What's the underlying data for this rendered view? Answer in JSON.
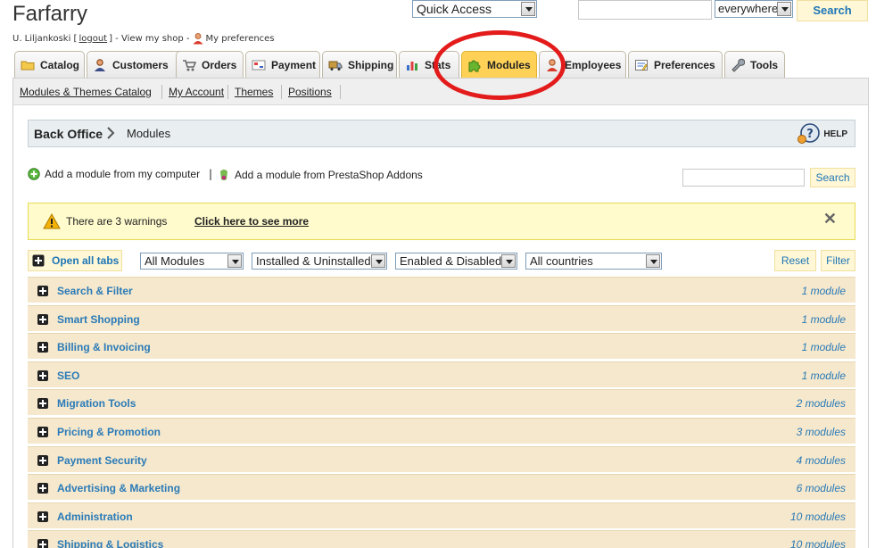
{
  "header": {
    "shop_name": "Farfarry",
    "user": "U. Liljankoski [",
    "logout": "logout",
    "after_logout": "] - View my shop -",
    "preferences": "My preferences"
  },
  "quick_access": {
    "label": "Quick Access"
  },
  "top_search": {
    "scope": "everywhere",
    "button": "Search",
    "value": ""
  },
  "tabs": [
    {
      "label": "Catalog",
      "icon": "folder-icon"
    },
    {
      "label": "Customers",
      "icon": "customers-icon"
    },
    {
      "label": "Orders",
      "icon": "cart-icon"
    },
    {
      "label": "Payment",
      "icon": "payment-icon"
    },
    {
      "label": "Shipping",
      "icon": "truck-icon"
    },
    {
      "label": "Stats",
      "icon": "stats-icon"
    },
    {
      "label": "Modules",
      "icon": "puzzle-icon"
    },
    {
      "label": "Employees",
      "icon": "employee-icon"
    },
    {
      "label": "Preferences",
      "icon": "preferences-icon"
    },
    {
      "label": "Tools",
      "icon": "wrench-icon"
    }
  ],
  "active_tab": "Modules",
  "subnav": [
    {
      "label": "Modules & Themes Catalog"
    },
    {
      "label": "My Account"
    },
    {
      "label": "Themes"
    },
    {
      "label": "Positions"
    }
  ],
  "breadcrumb": {
    "root": "Back Office",
    "current": "Modules",
    "help": "HELP"
  },
  "actions": {
    "add_from_computer": "Add a module from my computer",
    "separator": "|",
    "add_from_addons": "Add a module from PrestaShop Addons",
    "search_button": "Search"
  },
  "warning": {
    "text": "There are 3 warnings",
    "link": "Click here to see more",
    "close": "✕"
  },
  "filters": {
    "open_all_tabs": "Open all tabs",
    "type": "All Modules",
    "install_state": "Installed & Uninstalled",
    "enable_state": "Enabled & Disabled",
    "country": "All countries",
    "reset": "Reset",
    "filter": "Filter"
  },
  "categories": [
    {
      "name": "Search & Filter",
      "count": "1 module"
    },
    {
      "name": "Smart Shopping",
      "count": "1 module"
    },
    {
      "name": "Billing & Invoicing",
      "count": "1 module"
    },
    {
      "name": "SEO",
      "count": "1 module"
    },
    {
      "name": "Migration Tools",
      "count": "2 modules"
    },
    {
      "name": "Pricing & Promotion",
      "count": "3 modules"
    },
    {
      "name": "Payment Security",
      "count": "4 modules"
    },
    {
      "name": "Advertising & Marketing",
      "count": "6 modules"
    },
    {
      "name": "Administration",
      "count": "10 modules"
    },
    {
      "name": "Shipping & Logistics",
      "count": "10 modules"
    }
  ],
  "colors": {
    "active_tab": "#ffd257",
    "link_blue": "#2a7ab8",
    "category_row": "#f5e8cc",
    "warning_bg": "#fffbcc",
    "annotation_red": "#e31b1b"
  }
}
